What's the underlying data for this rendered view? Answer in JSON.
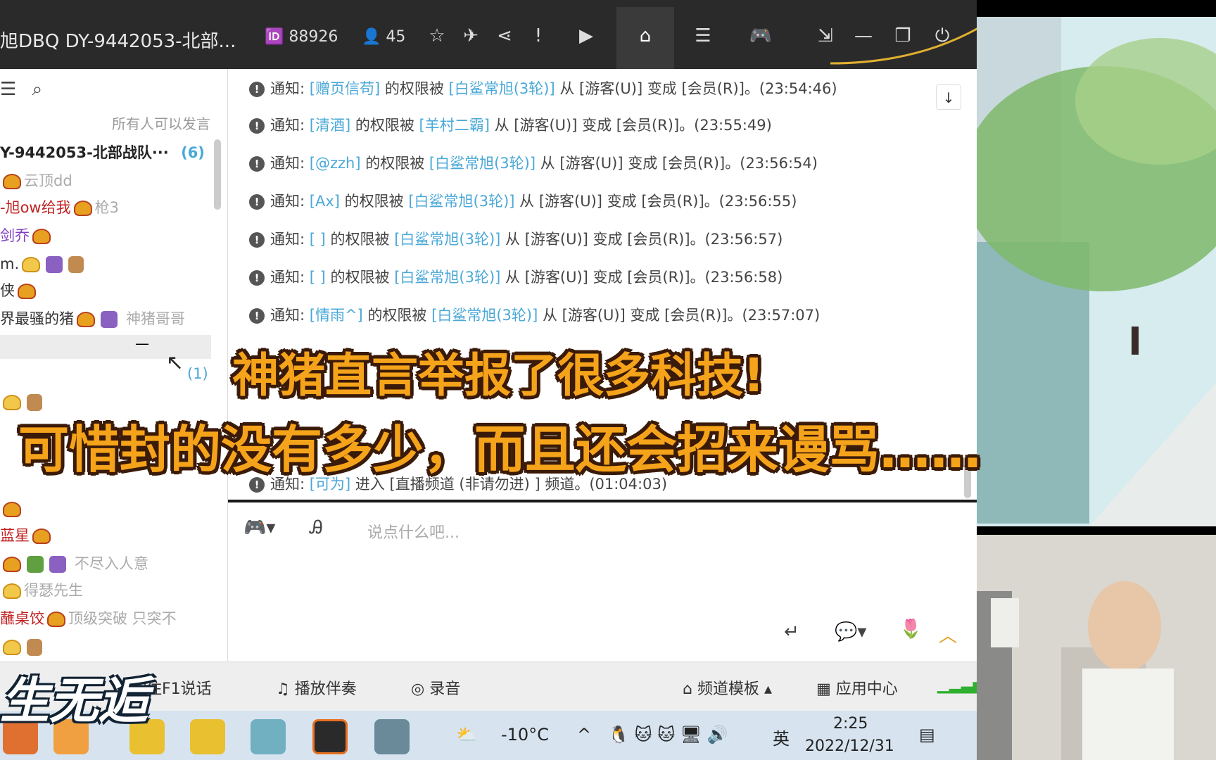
{
  "topbar": {
    "title": "旭DBQ DY-9442053-北部...",
    "room_id": "88926",
    "online_count": "45"
  },
  "userpanel": {
    "notice": "所有人可以发言",
    "channel_title": "Y-9442053-北部战队···",
    "channel_count": "(6)",
    "sub_count": "(1)",
    "users": [
      {
        "name": "",
        "tag": "云顶dd"
      },
      {
        "name": "-旭ow给我",
        "tag": "枪3"
      },
      {
        "name": "剑乔",
        "tag": ""
      },
      {
        "name": "m.",
        "tag": ""
      },
      {
        "name": "侠",
        "tag": ""
      },
      {
        "name": "界最骚的猪",
        "tag": "神猪哥哥"
      },
      {
        "name": "",
        "tag": ""
      },
      {
        "name": "蓝星",
        "tag": ""
      },
      {
        "name": "",
        "tag": "不尽入人意"
      },
      {
        "name": "",
        "tag": "得瑟先生"
      },
      {
        "name": "蘸桌饺",
        "tag": "顶级突破 只突不"
      }
    ]
  },
  "chat": {
    "messages": [
      {
        "prefix": "通知:",
        "user": "[赠页信苟]",
        "mid": "的权限被",
        "by": "[白鲨常旭(3轮)]",
        "rest": "从 [游客(U)] 变成 [会员(R)]。(23:54:46)"
      },
      {
        "prefix": "通知:",
        "user": "[清酒]",
        "mid": "的权限被",
        "by": "[羊村二霸]",
        "rest": "从 [游客(U)] 变成 [会员(R)]。(23:55:49)"
      },
      {
        "prefix": "通知:",
        "user": "[@zzh]",
        "mid": "的权限被",
        "by": "[白鲨常旭(3轮)]",
        "rest": "从 [游客(U)] 变成 [会员(R)]。(23:56:54)"
      },
      {
        "prefix": "通知:",
        "user": "[Ax]",
        "mid": "的权限被",
        "by": "[白鲨常旭(3轮)]",
        "rest": "从 [游客(U)] 变成 [会员(R)]。(23:56:55)"
      },
      {
        "prefix": "通知:",
        "user": "[ ]",
        "mid": "的权限被",
        "by": "[白鲨常旭(3轮)]",
        "rest": "从 [游客(U)] 变成 [会员(R)]。(23:56:57)"
      },
      {
        "prefix": "通知:",
        "user": "[ ]",
        "mid": "的权限被",
        "by": "[白鲨常旭(3轮)]",
        "rest": "从 [游客(U)] 变成 [会员(R)]。(23:56:58)"
      },
      {
        "prefix": "通知:",
        "user": "[情雨^]",
        "mid": "的权限被",
        "by": "[白鲨常旭(3轮)]",
        "rest": "从 [游客(U)] 变成 [会员(R)]。(23:57:07)"
      }
    ],
    "last": {
      "prefix": "通知:",
      "user": "[可为]",
      "rest": "进入 [直播频道 (非请勿进) ] 频道。(01:04:03)"
    }
  },
  "input": {
    "placeholder": "说点什么吧..."
  },
  "bottombar": {
    "ptt": "按住F1说话",
    "music": "播放伴奏",
    "record": "录音",
    "template": "频道模板",
    "apps": "应用中心"
  },
  "taskbar": {
    "temperature": "-10°C",
    "ime": "英",
    "time": "2:25",
    "date": "2022/12/31"
  },
  "captions": {
    "line1": "神猪直言举报了很多科技!",
    "line2": "可惜封的没有多少，而且还会招来谩骂……"
  },
  "watermark": "生无逅",
  "colors": {
    "caption": "#f5a31a",
    "link": "#4aa8d8",
    "topbar": "#2a2a2a"
  }
}
